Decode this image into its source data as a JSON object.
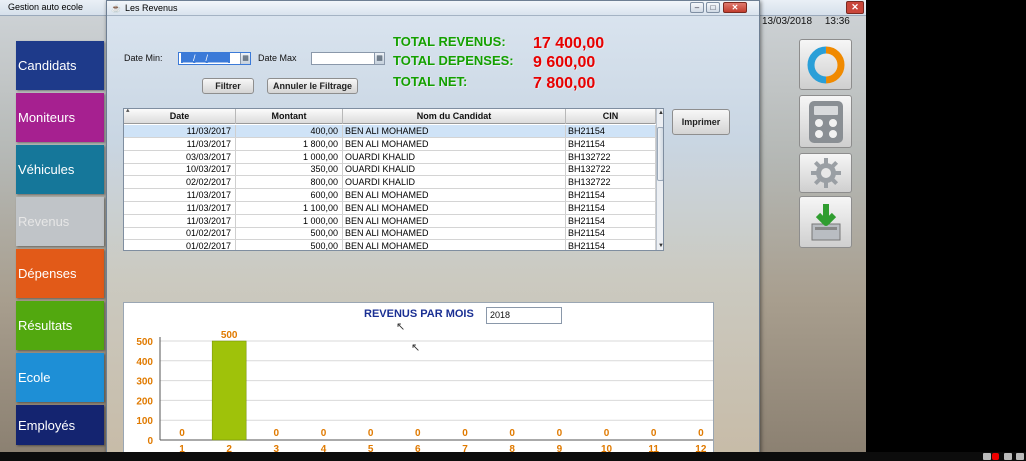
{
  "app": {
    "title": "Gestion auto ecole"
  },
  "datetime": {
    "date": "13/03/2018",
    "time": "13:36"
  },
  "sidebar": {
    "items": [
      {
        "label": "Candidats",
        "color": "#1e3a8a"
      },
      {
        "label": "Moniteurs",
        "color": "#a62090"
      },
      {
        "label": "Véhicules",
        "color": "#15779a"
      },
      {
        "label": "Revenus",
        "color": "#c0c4c8"
      },
      {
        "label": "Dépenses",
        "color": "#e25a18"
      },
      {
        "label": "Résultats",
        "color": "#52a80f"
      },
      {
        "label": "Ecole",
        "color": "#1e8fd6"
      },
      {
        "label": "Employés",
        "color": "#142470"
      }
    ]
  },
  "right_icons": [
    "sync-icon",
    "calculator-icon",
    "settings-gear-icon",
    "download-icon"
  ],
  "window": {
    "title": "Les Revenus"
  },
  "filter": {
    "date_min_label": "Date Min:",
    "date_min_value": "__/__/____",
    "date_max_label": "Date Max",
    "date_max_value": "",
    "filter_button": "Filtrer",
    "reset_button": "Annuler le Filtrage"
  },
  "totals": {
    "revenus_label": "TOTAL REVENUS:",
    "revenus_value": "17 400,00",
    "depenses_label": "TOTAL DEPENSES:",
    "depenses_value": "9 600,00",
    "net_label": "TOTAL NET:",
    "net_value": "7 800,00"
  },
  "print_button": "Imprimer",
  "table": {
    "columns": [
      "Date",
      "Montant",
      "Nom du Candidat",
      "CIN"
    ],
    "rows": [
      [
        "11/03/2017",
        "400,00",
        "BEN ALI MOHAMED",
        "BH21154"
      ],
      [
        "11/03/2017",
        "1 800,00",
        "BEN ALI MOHAMED",
        "BH21154"
      ],
      [
        "03/03/2017",
        "1 000,00",
        "OUARDI KHALID",
        "BH132722"
      ],
      [
        "10/03/2017",
        "350,00",
        "OUARDI KHALID",
        "BH132722"
      ],
      [
        "02/02/2017",
        "800,00",
        "OUARDI KHALID",
        "BH132722"
      ],
      [
        "11/03/2017",
        "600,00",
        "BEN ALI MOHAMED",
        "BH21154"
      ],
      [
        "11/03/2017",
        "1 100,00",
        "BEN ALI MOHAMED",
        "BH21154"
      ],
      [
        "11/03/2017",
        "1 000,00",
        "BEN ALI MOHAMED",
        "BH21154"
      ],
      [
        "01/02/2017",
        "500,00",
        "BEN ALI MOHAMED",
        "BH21154"
      ],
      [
        "01/02/2017",
        "500,00",
        "BEN ALI MOHAMED",
        "BH21154"
      ]
    ]
  },
  "chart_data": {
    "type": "bar",
    "title": "REVENUS PAR MOIS",
    "year_selector": "2018",
    "categories": [
      "1",
      "2",
      "3",
      "4",
      "5",
      "6",
      "7",
      "8",
      "9",
      "10",
      "11",
      "12"
    ],
    "values": [
      0,
      500,
      0,
      0,
      0,
      0,
      0,
      0,
      0,
      0,
      0,
      0
    ],
    "ylim": [
      0,
      500
    ],
    "yticks": [
      0,
      100,
      200,
      300,
      400,
      500
    ],
    "grid": true,
    "bar_color": "#9fc20a",
    "label_color": "#e07a00"
  }
}
